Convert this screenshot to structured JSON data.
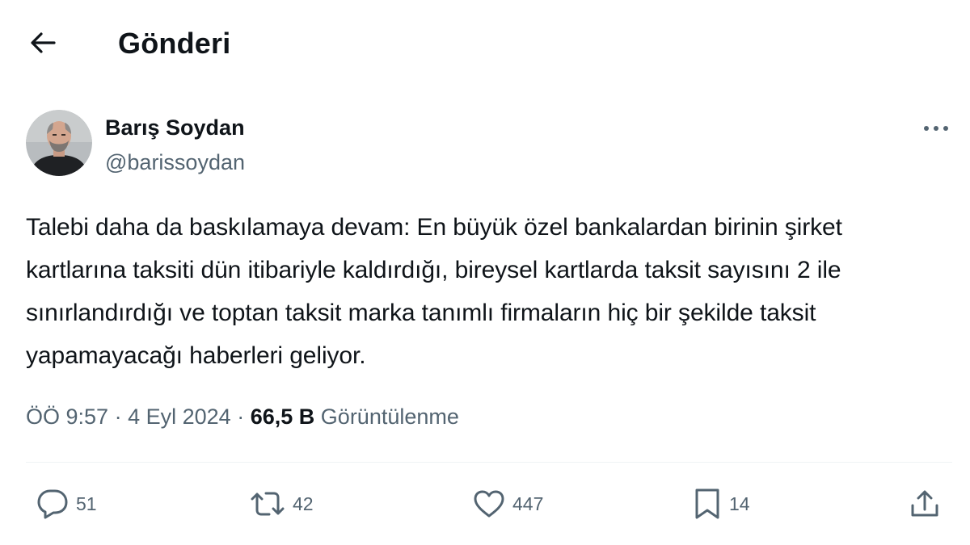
{
  "header": {
    "title": "Gönderi"
  },
  "author": {
    "name": "Barış Soydan",
    "handle": "@barissoydan"
  },
  "tweet": {
    "text": "Talebi daha da baskılamaya devam: En büyük özel bankalardan birinin şirket kartlarına taksiti dün itibariyle kaldırdığı, bireysel kartlarda taksit sayısını 2 ile sınırlandırdığı ve toptan taksit marka tanımlı firmaların hiç bir şekilde taksit yapamayacağı haberleri geliyor."
  },
  "meta": {
    "time": "ÖÖ 9:57",
    "sep1": "·",
    "date": "4 Eyl 2024",
    "sep2": "·",
    "views_count": "66,5 B",
    "views_label": "Görüntülenme"
  },
  "actions": {
    "reply": {
      "icon": "reply-icon",
      "count": "51"
    },
    "retweet": {
      "icon": "retweet-icon",
      "count": "42"
    },
    "like": {
      "icon": "heart-icon",
      "count": "447"
    },
    "bookmark": {
      "icon": "bookmark-icon",
      "count": "14"
    },
    "share": {
      "icon": "share-icon"
    }
  },
  "colors": {
    "text_primary": "#0f1419",
    "text_secondary": "#536471",
    "divider": "#eff3f4"
  }
}
